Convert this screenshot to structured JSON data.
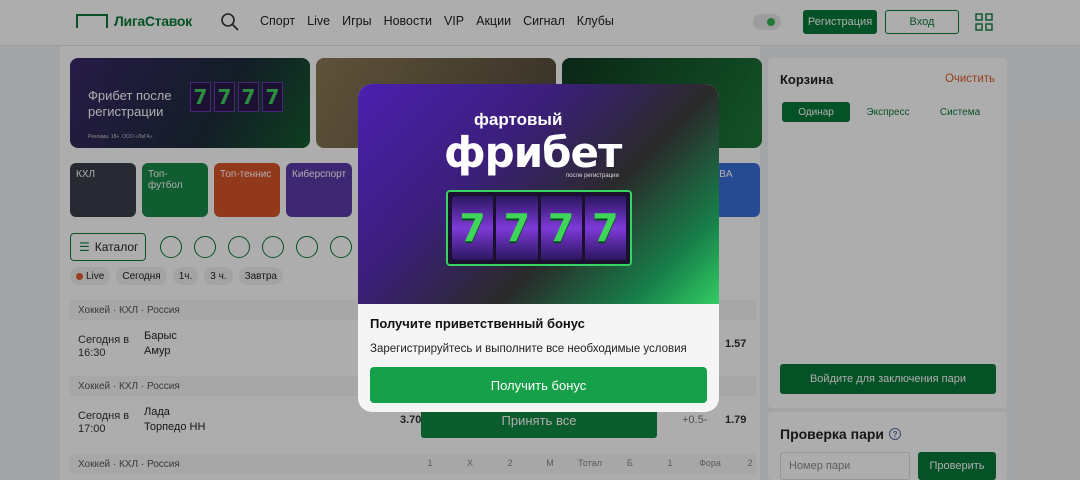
{
  "header": {
    "logo_text": "ЛигаСтавок",
    "nav": [
      "Спорт",
      "Live",
      "Игры",
      "Новости",
      "VIP",
      "Акции",
      "Сигнал",
      "Клубы"
    ],
    "register_label": "Регистрация",
    "login_label": "Вход",
    "brand_color": "#0a7a3a"
  },
  "banners": {
    "b1_title": "Фрибет после регистрации",
    "b1_slots": [
      "7",
      "7",
      "7",
      "7"
    ],
    "b1_small": "Реклама. 18+. ООО «ЛиГА»"
  },
  "categories": [
    {
      "label": "КХЛ",
      "color": "#3a3f4a"
    },
    {
      "label": "Топ-футбол",
      "color": "#1a8a4a"
    },
    {
      "label": "Топ-теннис",
      "color": "#d8542a"
    },
    {
      "label": "Киберспорт",
      "color": "#5a3aa8"
    },
    {
      "label": "NBA",
      "color": "#3a6fd8"
    }
  ],
  "catalog_label": "Каталог",
  "filters": [
    "Live",
    "Сегодня",
    "1ч.",
    "3 ч.",
    "Завтра"
  ],
  "events": [
    {
      "league": "Хоккей · КХЛ · Россия",
      "time": "Сегодня в 16:30",
      "team1": "Барыс",
      "team2": "Амур",
      "odd": "1.57"
    },
    {
      "league": "Хоккей · КХЛ · Россия",
      "time": "Сегодня в 17:00",
      "team1": "Лада",
      "team2": "Торпедо НН",
      "odd_left": "3.70",
      "odd_mid": "+0.5-",
      "odd": "1.79"
    },
    {
      "league": "Хоккей · КХЛ · Россия"
    }
  ],
  "market_headers": [
    "1",
    "X",
    "2",
    "М",
    "Тотал",
    "Б",
    "1",
    "Фора",
    "2"
  ],
  "accept_all_label": "Принять все",
  "cart": {
    "title": "Корзина",
    "clear": "Очистить",
    "tabs": [
      "Одинар",
      "Экспресс",
      "Система"
    ],
    "login_label": "Войдите для заключения пари"
  },
  "check": {
    "title": "Проверка пари",
    "placeholder": "Номер пари",
    "button": "Проверить"
  },
  "modal": {
    "subtitle": "фартовый",
    "title": "фрибет",
    "small": "после регистрации",
    "slots": [
      "7",
      "7",
      "7",
      "7"
    ],
    "heading": "Получите приветственный бонус",
    "text": "Зарегистрируйтесь и выполните все необходимые условия",
    "button": "Получить бонус"
  }
}
